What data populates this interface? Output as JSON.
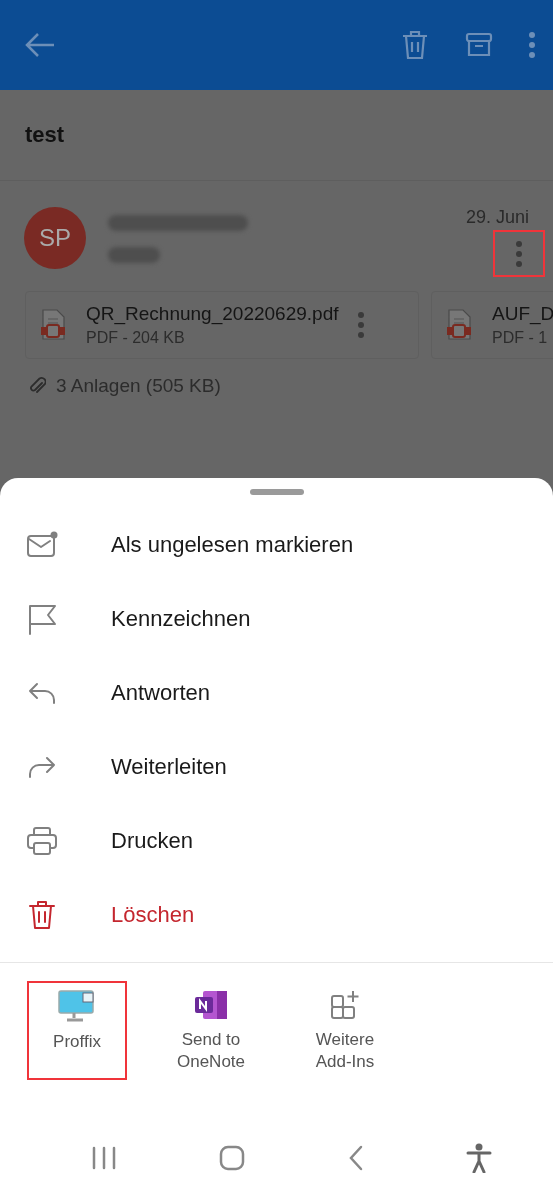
{
  "subject": "test",
  "message": {
    "avatar_initials": "SP",
    "sender_blurred": true,
    "date": "29. Juni",
    "more_highlighted": true
  },
  "attachments": [
    {
      "name": "QR_Rechnung_20220629.pdf",
      "meta": "PDF - 204 KB"
    },
    {
      "name": "AUF_D",
      "meta": "PDF - 1"
    }
  ],
  "attachment_summary": "3 Anlagen (505 KB)",
  "sheet": {
    "actions": [
      {
        "kind": "unread",
        "label": "Als ungelesen markieren"
      },
      {
        "kind": "flag",
        "label": "Kennzeichnen"
      },
      {
        "kind": "reply",
        "label": "Antworten"
      },
      {
        "kind": "forward",
        "label": "Weiterleiten"
      },
      {
        "kind": "print",
        "label": "Drucken"
      },
      {
        "kind": "delete",
        "label": "Löschen"
      }
    ],
    "addins": [
      {
        "kind": "proffix",
        "label": "Proffix",
        "highlighted": true
      },
      {
        "kind": "onenote",
        "label": "Send to OneNote",
        "highlighted": false
      },
      {
        "kind": "more",
        "label": "Weitere Add-Ins",
        "highlighted": false
      }
    ]
  }
}
